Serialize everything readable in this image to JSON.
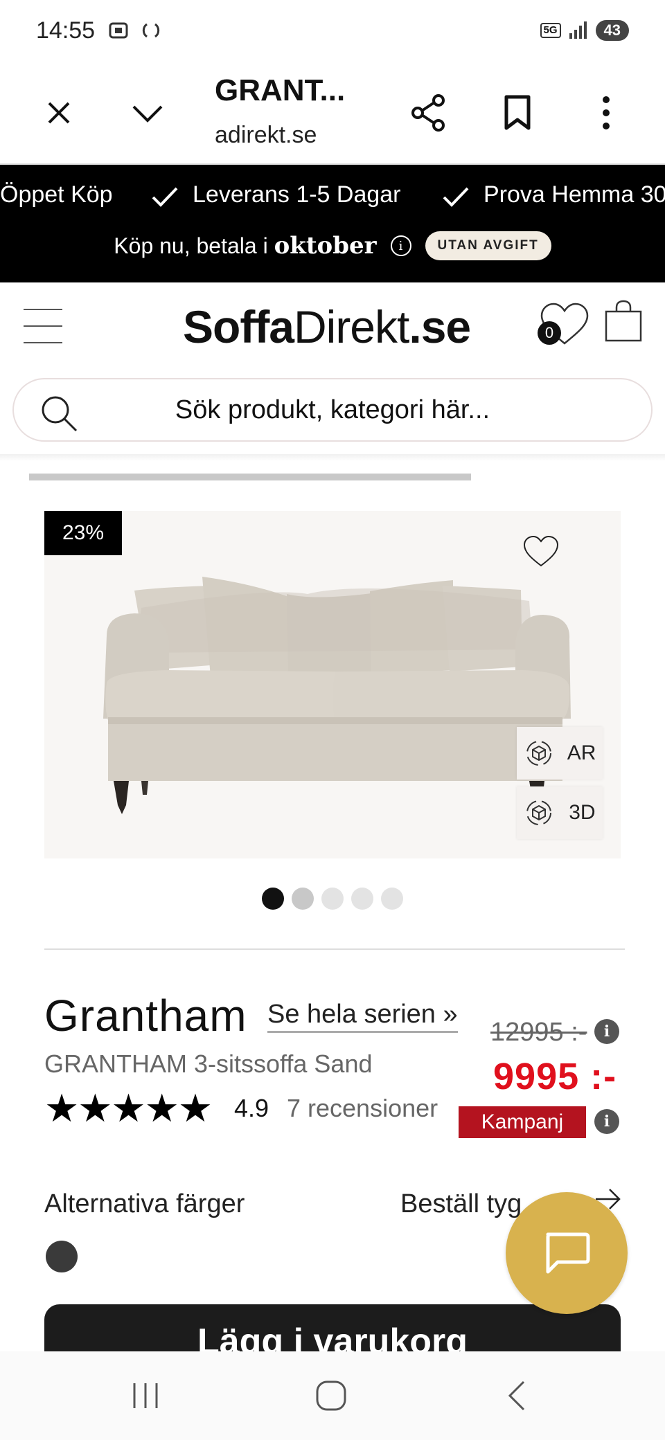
{
  "status_bar": {
    "time": "14:55",
    "network": "5G",
    "battery": "43"
  },
  "browser": {
    "title": "GRANT...",
    "url": "adirekt.se"
  },
  "promo": {
    "items": [
      "Öppet Köp",
      "Leverans 1-5 Dagar",
      "Prova Hemma 30"
    ],
    "pay_prefix": "Köp nu, betala i",
    "pay_month": "oktober",
    "pill": "UTAN AVGIFT"
  },
  "header": {
    "logo_bold": "Soffa",
    "logo_regular": "Direkt",
    "logo_suffix": ".se",
    "cart_count": "0"
  },
  "search": {
    "placeholder": "Sök produkt, kategori här..."
  },
  "product": {
    "discount": "23%",
    "ar_label": "AR",
    "d3_label": "3D",
    "gallery_count": 5,
    "gallery_active": 1,
    "name": "Grantham",
    "series_link": "Se hela serien »",
    "subname": "GRANTHAM 3-sitssoffa Sand",
    "old_price": "12995 :-",
    "new_price": "9995 :-",
    "stars": "★★★★★",
    "rating": "4.9",
    "reviews": "7 recensioner",
    "campaign": "Kampanj",
    "alt_colors_label": "Alternativa färger",
    "order_fabric_label": "Beställ tyg",
    "add_to_cart": "Lägg i varukorg"
  },
  "colors": {
    "accent_chat": "#d8b24e",
    "price_red": "#e0101d",
    "campaign_red": "#b4131f",
    "promo_bg": "#000000"
  }
}
